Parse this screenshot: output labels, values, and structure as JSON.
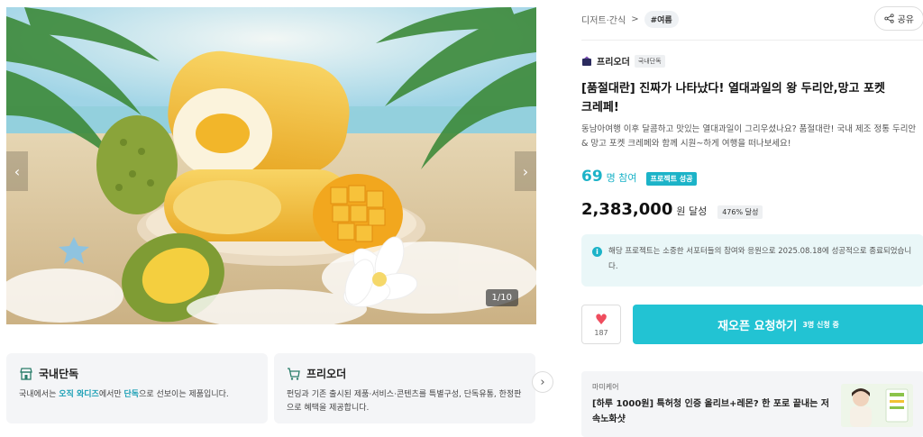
{
  "gallery": {
    "counter": "1/10",
    "prev_icon": "chevron-left-icon",
    "next_icon": "chevron-right-icon"
  },
  "cards": [
    {
      "icon": "store-icon",
      "title": "국내단독",
      "desc_pre": "국내에서는 ",
      "desc_hl1": "오직 와디즈",
      "desc_mid": "에서만 ",
      "desc_hl2": "단독",
      "desc_post": "으로 선보이는 제품입니다."
    },
    {
      "icon": "cart-icon",
      "title": "프리오더",
      "desc": "펀딩과 기존 출시된 제품·서비스·콘텐츠를 특별구성, 단독유통, 한정판으로 혜택을 제공합니다."
    }
  ],
  "cards_next_icon": "chevron-right-icon",
  "breadcrumb": {
    "category": "디저트·간식",
    "separator": ">",
    "tag": "#여름"
  },
  "share": {
    "label": "공유",
    "icon": "share-icon"
  },
  "brand": {
    "name": "프리오더",
    "badge": "국내단독"
  },
  "title": "[품절대란] 진짜가 나타났다! 열대과일의 왕 두리안,망고 포켓 크레페!",
  "description": "동남아여행 이후 달콤하고 맛있는 열대과일이 그리우셨나요? 품절대란! 국내 제조 정통 두리안 & 망고 포켓 크레페와 함께 시원~하게 여행을 떠나보세요!",
  "participants": {
    "count": "69",
    "unit": "명 참여",
    "status": "프로젝트 성공"
  },
  "amount": {
    "value": "2,383,000",
    "unit": "원 달성",
    "percent": "476% 달성"
  },
  "notice": "해당 프로젝트는 소중한 서포터들의 참여와 응원으로 2025.08.18에 성공적으로 종료되었습니다.",
  "like": {
    "count": "187",
    "icon": "heart-icon"
  },
  "reopen": {
    "label": "재오픈 요청하기",
    "sub": "3명 신청 중"
  },
  "ad": {
    "brand": "마미케어",
    "text": "[하루 1000원] 특허청 인증 올리브+레몬? 한 포로 끝내는 저속노화샷"
  },
  "colors": {
    "accent": "#22c3d3",
    "heart": "#ef4d5e"
  }
}
